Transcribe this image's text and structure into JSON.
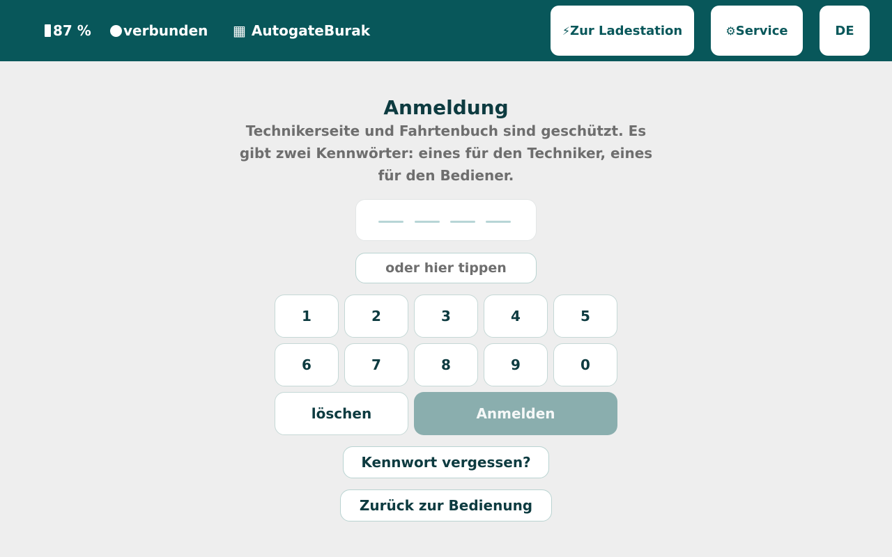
{
  "status": {
    "battery_icon": "battery-icon",
    "battery_text": "87 %",
    "connection_icon": "connected-dot-icon",
    "connection_text": "verbunden",
    "device_icon": "grid-icon",
    "device_name": "AutogateBurak"
  },
  "nav": {
    "charge_glyph": "⚡",
    "charge_label": "Zur Ladestation",
    "service_glyph": "⚙",
    "service_label": "Service",
    "language": "DE"
  },
  "login": {
    "title": "Anmeldung",
    "description": "Technikerseite und Fahrtenbuch sind geschützt. Es gibt zwei Kennwörter: eines für den Techniker, eines für den Bediener.",
    "pin_length": 4,
    "type_hint": "oder hier tippen",
    "keys": [
      "1",
      "2",
      "3",
      "4",
      "5",
      "6",
      "7",
      "8",
      "9",
      "0"
    ],
    "delete_label": "löschen",
    "submit_label": "Anmelden",
    "forgot_label": "Kennwort vergessen?",
    "back_label": "Zurück zur Bedienung"
  },
  "colors": {
    "header": "#08575a",
    "background": "#eeeeee",
    "accent_disabled": "#8aaeae",
    "text_dark": "#0d3b40"
  }
}
